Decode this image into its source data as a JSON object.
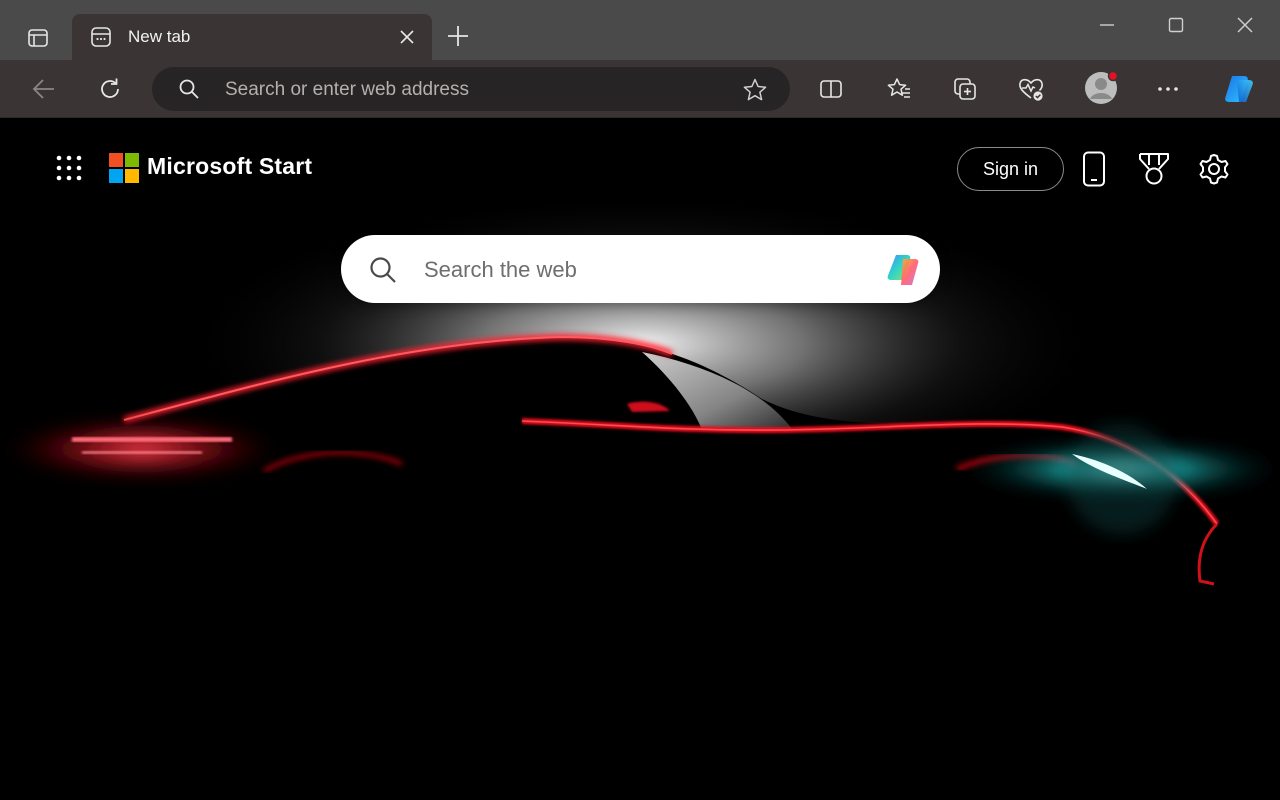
{
  "browser": {
    "tab": {
      "title": "New tab",
      "icons": {
        "favicon": "new-tab-page-icon",
        "close": "close-icon"
      }
    },
    "titlebar_icons": {
      "tab_actions": "tab-actions-icon",
      "new_tab": "plus-icon",
      "minimize": "minimize-icon",
      "maximize": "maximize-icon",
      "close": "close-icon"
    },
    "address_bar": {
      "placeholder": "Search or enter web address",
      "icons": [
        "search-icon",
        "star-icon"
      ]
    },
    "toolbar_icons": [
      "back-arrow-icon",
      "refresh-icon",
      "split-screen-icon",
      "favorites-icon",
      "collections-icon",
      "browser-essentials-icon",
      "profile-avatar-icon",
      "more-icon",
      "copilot-icon"
    ],
    "colors": {
      "titlebar": "#4a4a4a",
      "tab_active": "#3a3534",
      "toolbar": "#3a3534",
      "address_field": "#262424"
    }
  },
  "page": {
    "brand": "Microsoft Start",
    "sign_in_label": "Sign in",
    "header_icons": [
      "app-launcher-icon",
      "mobile-phone-icon",
      "rewards-medal-icon",
      "settings-gear-icon"
    ],
    "search": {
      "placeholder": "Search the web",
      "icons": [
        "search-icon",
        "copilot-icon"
      ]
    },
    "background": {
      "description_colors": {
        "base": "#000000",
        "car_outline": "#e0101a",
        "tail_light": "#ff2a3a",
        "head_light": "#22d8d8"
      }
    }
  }
}
